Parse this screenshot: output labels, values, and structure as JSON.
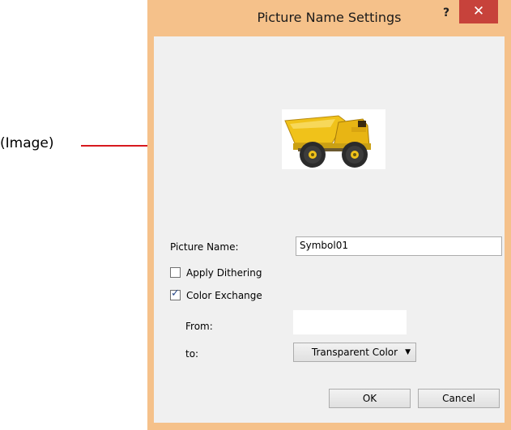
{
  "callout": {
    "label": "(Image)",
    "line_color": "#d7191e"
  },
  "dialog": {
    "title": "Picture Name Settings",
    "help_label": "?",
    "close_label": "✕",
    "frame_color": "#f5c18a",
    "close_color": "#c7423b",
    "preview_icon": "dump-truck-icon",
    "picture_name": {
      "label": "Picture Name:",
      "value": "Symbol01"
    },
    "apply_dithering": {
      "label": "Apply Dithering",
      "checked": false
    },
    "color_exchange": {
      "label": "Color Exchange",
      "checked": true
    },
    "from": {
      "label": "From:",
      "value": ""
    },
    "to": {
      "label": "to:",
      "value": "Transparent Color"
    },
    "ok_label": "OK",
    "cancel_label": "Cancel"
  }
}
